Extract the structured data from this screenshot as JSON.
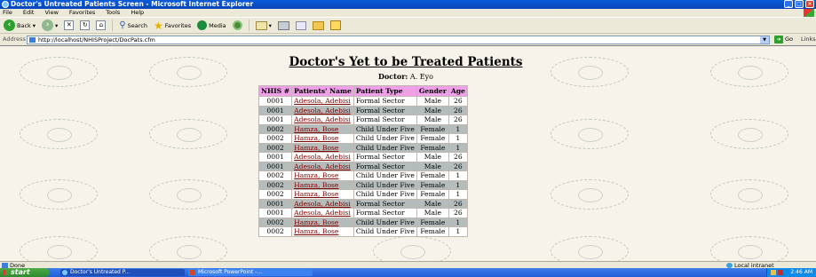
{
  "window": {
    "title": "Doctor's Untreated Patients Screen - Microsoft Internet Explorer"
  },
  "menu": [
    "File",
    "Edit",
    "View",
    "Favorites",
    "Tools",
    "Help"
  ],
  "toolbar": {
    "back": "Back",
    "search": "Search",
    "favorites": "Favorites",
    "media": "Media"
  },
  "address": {
    "label": "Address",
    "url": "http://localhost/NHISProject/DocPats.cfm",
    "go": "Go",
    "links": "Links"
  },
  "page": {
    "heading": "Doctor's Yet to be Treated Patients",
    "doctor_label": "Doctor:",
    "doctor_name": "A. Eyo",
    "columns": [
      "NHIS #",
      "Patients' Name",
      "Patient Type",
      "Gender",
      "Age"
    ],
    "rows": [
      [
        "0001",
        "Adesola, Adebisi",
        "Formal Sector",
        "Male",
        "26"
      ],
      [
        "0001",
        "Adesola, Adebisi",
        "Formal Sector",
        "Male",
        "26"
      ],
      [
        "0001",
        "Adesola, Adebisi",
        "Formal Sector",
        "Male",
        "26"
      ],
      [
        "0002",
        "Hamza, Bose",
        "Child Under Five",
        "Female",
        "1"
      ],
      [
        "0002",
        "Hamza, Bose",
        "Child Under Five",
        "Female",
        "1"
      ],
      [
        "0002",
        "Hamza, Bose",
        "Child Under Five",
        "Female",
        "1"
      ],
      [
        "0001",
        "Adesola, Adebisi",
        "Formal Sector",
        "Male",
        "26"
      ],
      [
        "0001",
        "Adesola, Adebisi",
        "Formal Sector",
        "Male",
        "26"
      ],
      [
        "0002",
        "Hamza, Bose",
        "Child Under Five",
        "Female",
        "1"
      ],
      [
        "0002",
        "Hamza, Bose",
        "Child Under Five",
        "Female",
        "1"
      ],
      [
        "0002",
        "Hamza, Bose",
        "Child Under Five",
        "Female",
        "1"
      ],
      [
        "0001",
        "Adesola, Adebisi",
        "Formal Sector",
        "Male",
        "26"
      ],
      [
        "0001",
        "Adesola, Adebisi",
        "Formal Sector",
        "Male",
        "26"
      ],
      [
        "0002",
        "Hamza, Bose",
        "Child Under Five",
        "Female",
        "1"
      ],
      [
        "0002",
        "Hamza, Bose",
        "Child Under Five",
        "Female",
        "1"
      ]
    ]
  },
  "status": {
    "text": "Done",
    "zone": "Local intranet"
  },
  "taskbar": {
    "start": "start",
    "task1": "Doctor's Untreated P...",
    "task2": "Microsoft PowerPoint -...",
    "clock": "2:46 AM"
  },
  "colors": {
    "header_bg": "#f0a0e8",
    "even_row_bg": "#b4bcbc",
    "link_color": "#800000"
  }
}
